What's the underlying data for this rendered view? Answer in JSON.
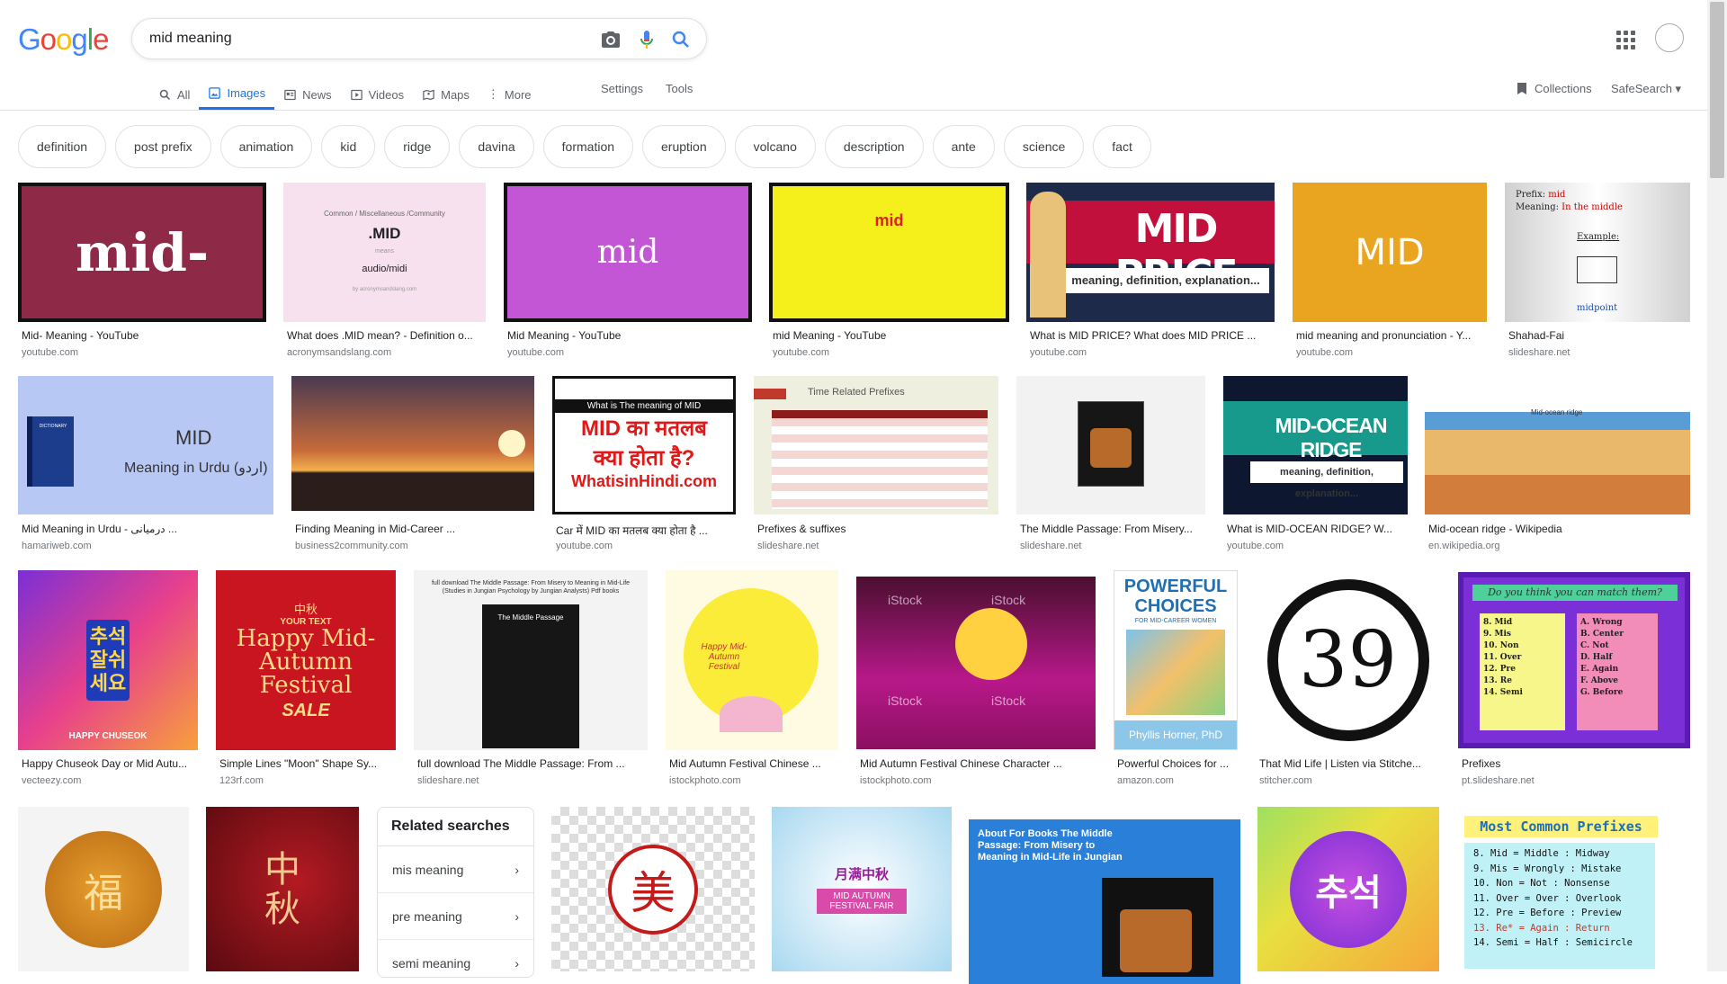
{
  "logo": {
    "letters": [
      "G",
      "o",
      "o",
      "g",
      "l",
      "e"
    ]
  },
  "search": {
    "query": "mid meaning"
  },
  "tabs": [
    {
      "label": "All"
    },
    {
      "label": "Images"
    },
    {
      "label": "News"
    },
    {
      "label": "Videos"
    },
    {
      "label": "Maps"
    },
    {
      "label": "More"
    }
  ],
  "settings_label": "Settings",
  "tools_label": "Tools",
  "collections_label": "Collections",
  "safesearch_label": "SafeSearch",
  "chips": [
    "definition",
    "post prefix",
    "animation",
    "kid",
    "ridge",
    "davina",
    "formation",
    "eruption",
    "volcano",
    "description",
    "ante",
    "science",
    "fact"
  ],
  "row1": [
    {
      "caption": "Mid- Meaning - YouTube",
      "source": "youtube.com",
      "art": "mid-"
    },
    {
      "caption": "What does .MID mean? - Definition o...",
      "source": "acronymsandslang.com",
      "art": ".MID",
      "art_top": "Common / Miscellaneous /Community",
      "art_mid": "means",
      "art_bottom": "audio/midi",
      "art_foot": "by acronymsandslang.com"
    },
    {
      "caption": "Mid Meaning - YouTube",
      "source": "youtube.com",
      "art": "mid"
    },
    {
      "caption": "mid Meaning - YouTube",
      "source": "youtube.com",
      "art": "mid"
    },
    {
      "caption": "What is MID PRICE? What does MID PRICE ...",
      "source": "youtube.com",
      "art": "MID PRICE",
      "art_sub": "meaning, definition, explanation..."
    },
    {
      "caption": "mid meaning and pronunciation - Y...",
      "source": "youtube.com",
      "art": "MID"
    },
    {
      "caption": "Shahad-Fai",
      "source": "slideshare.net",
      "art_prefix": "Prefix:",
      "art_prefix_val": "mid",
      "art_meaning": "Meaning:",
      "art_meaning_val": "In the middle",
      "art_example": "Example:",
      "art_mp": "midpoint"
    }
  ],
  "row2": [
    {
      "caption": "Mid Meaning in Urdu - درمیانی ...",
      "source": "hamariweb.com",
      "art": "MID",
      "art_sub": "Meaning in Urdu (اردو)",
      "art_book": "DICTIONARY"
    },
    {
      "caption": "Finding Meaning in Mid-Career ...",
      "source": "business2community.com"
    },
    {
      "caption": "Car में MID का मतलब क्या होता है ...",
      "source": "youtube.com",
      "art_top": "What is The meaning of MID",
      "art_main": "MID का मतलब",
      "art_main2": "क्या होता है?",
      "art_foot": "WhatisinHindi.com"
    },
    {
      "caption": "Prefixes & suffixes",
      "source": "slideshare.net",
      "art": "Time Related Prefixes"
    },
    {
      "caption": "The Middle Passage: From Misery...",
      "source": "slideshare.net"
    },
    {
      "caption": "What is MID-OCEAN RIDGE? W...",
      "source": "youtube.com",
      "art": "MID-OCEAN RIDGE",
      "art_sub": "meaning, definition, explanation..."
    },
    {
      "caption": "Mid-ocean ridge - Wikipedia",
      "source": "en.wikipedia.org",
      "art": "Mid-ocean ridge"
    }
  ],
  "row3": [
    {
      "caption": "Happy Chuseok Day or Mid Autu...",
      "source": "vecteezy.com",
      "art": "추석 잘쉬세요",
      "art_sub": "HAPPY CHUSEOK"
    },
    {
      "caption": "Simple Lines \"Moon\" Shape Sy...",
      "source": "123rf.com",
      "art_top": "中秋",
      "art_your": "YOUR TEXT",
      "art": "Happy Mid-Autumn Festival",
      "art_sale": "SALE"
    },
    {
      "caption": "full download The Middle Passage: From ...",
      "source": "slideshare.net",
      "art_top": "full download The Middle Passage: From Misery to Meaning in Mid-Life (Studies in Jungian Psychology by Jungian Analysts) Pdf books",
      "art_book": "The Middle Passage"
    },
    {
      "caption": "Mid Autumn Festival Chinese ...",
      "source": "istockphoto.com",
      "art": "Happy Mid-Autumn Festival"
    },
    {
      "caption": "Mid Autumn Festival Chinese Character ...",
      "source": "istockphoto.com",
      "art": "iStock"
    },
    {
      "caption": "Powerful Choices for ...",
      "source": "amazon.com",
      "art": "POWERFUL CHOICES",
      "art_sub": "FOR MID-CAREER WOMEN",
      "art_author": "Phyllis Horner, PhD"
    },
    {
      "caption": "That Mid Life | Listen via Stitche...",
      "source": "stitcher.com",
      "art": "39"
    },
    {
      "caption": "Prefixes",
      "source": "pt.slideshare.net",
      "art_top": "Do you think you can match them?",
      "left": [
        "8. Mid",
        "9. Mis",
        "10. Non",
        "11. Over",
        "12. Pre",
        "13. Re",
        "14. Semi"
      ],
      "right": [
        "A. Wrong",
        "B. Center",
        "C. Not",
        "D. Half",
        "E. Again",
        "F. Above",
        "G. Before"
      ]
    }
  ],
  "related": {
    "title": "Related searches",
    "items": [
      "mis meaning",
      "pre meaning",
      "semi meaning"
    ]
  },
  "row4": [
    {
      "art": "福"
    },
    {
      "art": "中秋"
    },
    {
      "art": "美"
    },
    {
      "art": "月满中秋",
      "art_sub": "MID AUTUMN FESTIVAL FAIR"
    },
    {
      "art": "About For Books  The Middle Passage: From Misery to Meaning in Mid-Life in Jungian"
    },
    {
      "art": "추석"
    },
    {
      "art": "Most Common Prefixes",
      "lines": [
        "8.  Mid = Middle : Midway",
        "9.  Mis = Wrongly : Mistake",
        "10. Non = Not : Nonsense",
        "11. Over = Over : Overlook",
        "12. Pre = Before : Preview",
        "13. Re* = Again : Return",
        "14. Semi = Half : Semicircle"
      ]
    }
  ]
}
